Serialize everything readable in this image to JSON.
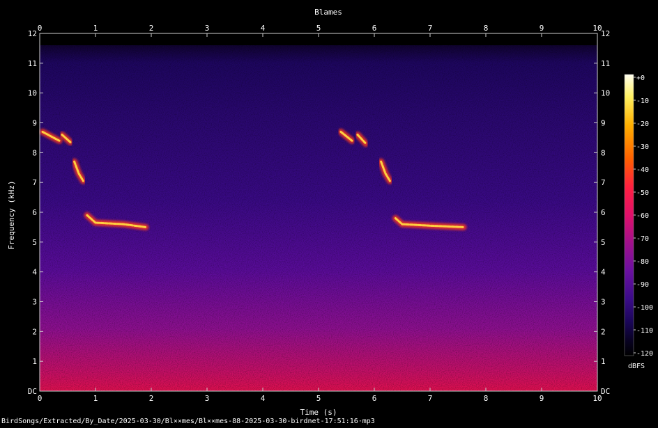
{
  "chart_data": {
    "type": "heatmap",
    "title": "Blames",
    "xlabel": "Time (s)",
    "ylabel": "Frequency (kHz)",
    "x_ticks": [
      "0",
      "1",
      "2",
      "3",
      "4",
      "5",
      "6",
      "7",
      "8",
      "9",
      "10"
    ],
    "y_ticks": [
      "DC",
      "1",
      "2",
      "3",
      "4",
      "5",
      "6",
      "7",
      "8",
      "9",
      "10",
      "11",
      "12"
    ],
    "xlim": [
      0,
      10
    ],
    "ylim": [
      0,
      12
    ],
    "colorbar": {
      "label": "dBFS",
      "ticks": [
        "+0",
        "-10",
        "-20",
        "-30",
        "-40",
        "-50",
        "-60",
        "-70",
        "-80",
        "-90",
        "-100",
        "-110",
        "-120"
      ],
      "range": [
        -120,
        0
      ],
      "colormap": [
        "#fffff0",
        "#fff060",
        "#ffb000",
        "#ff6000",
        "#ff2040",
        "#e0106a",
        "#a0108c",
        "#6a10a0",
        "#3a0c88",
        "#1a0658",
        "#080220",
        "#000000"
      ]
    },
    "grid": false,
    "description_source": "spectrogram",
    "bright_traces": [
      {
        "name": "",
        "points": [
          [
            0.05,
            8.7
          ],
          [
            0.2,
            8.55
          ],
          [
            0.35,
            8.4
          ]
        ]
      },
      {
        "name": "",
        "points": [
          [
            0.4,
            8.6
          ],
          [
            0.55,
            8.35
          ]
        ]
      },
      {
        "name": "",
        "points": [
          [
            0.62,
            7.7
          ],
          [
            0.7,
            7.3
          ],
          [
            0.78,
            7.05
          ]
        ]
      },
      {
        "name": "",
        "points": [
          [
            0.85,
            5.9
          ],
          [
            1.0,
            5.65
          ],
          [
            1.5,
            5.6
          ],
          [
            1.9,
            5.5
          ]
        ]
      },
      {
        "name": "",
        "points": [
          [
            5.4,
            8.7
          ],
          [
            5.6,
            8.4
          ]
        ]
      },
      {
        "name": "",
        "points": [
          [
            5.7,
            8.6
          ],
          [
            5.85,
            8.3
          ]
        ]
      },
      {
        "name": "",
        "points": [
          [
            6.12,
            7.7
          ],
          [
            6.2,
            7.3
          ],
          [
            6.28,
            7.05
          ]
        ]
      },
      {
        "name": "",
        "points": [
          [
            6.38,
            5.8
          ],
          [
            6.5,
            5.6
          ],
          [
            7.0,
            5.55
          ],
          [
            7.6,
            5.5
          ]
        ]
      }
    ]
  },
  "footer": {
    "path": "BirdSongs/Extracted/By_Date/2025-03-30/Bl××mes/Bl××mes-88-2025-03-30-birdnet-17:51:16·mp3"
  }
}
